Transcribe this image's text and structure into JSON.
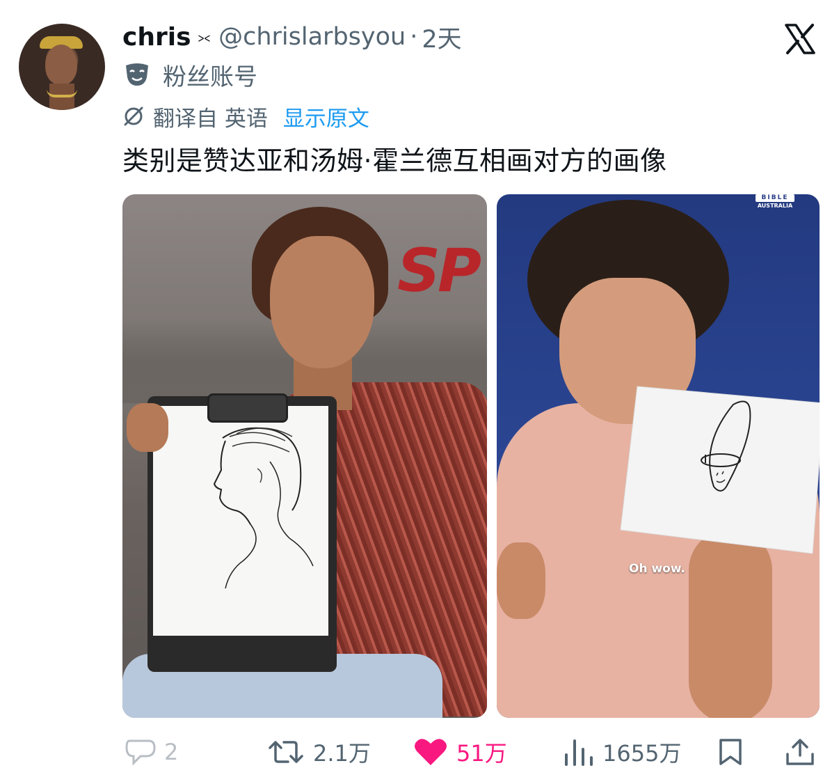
{
  "tweet": {
    "display_name": "chris",
    "name_emoji": "⪥",
    "handle": "@chrislarbsyou",
    "separator": "·",
    "time": "2天",
    "account_label": "粉丝账号",
    "translated_from": "翻译自 英语",
    "show_original": "显示原文",
    "text": "类别是赞达亚和汤姆·霍兰德互相画对方的画像"
  },
  "media": {
    "left": {
      "poster_text": "SP"
    },
    "right": {
      "watermark_top": "BIBLE",
      "watermark_bottom": "AUSTRALIA",
      "caption": "Oh wow."
    }
  },
  "actions": {
    "reply_count": "2",
    "retweet_count": "2.1万",
    "like_count": "51万",
    "view_count": "1655万"
  },
  "colors": {
    "text": "#0f1419",
    "secondary": "#536471",
    "link": "#1d9bf0",
    "like": "#f91880"
  }
}
